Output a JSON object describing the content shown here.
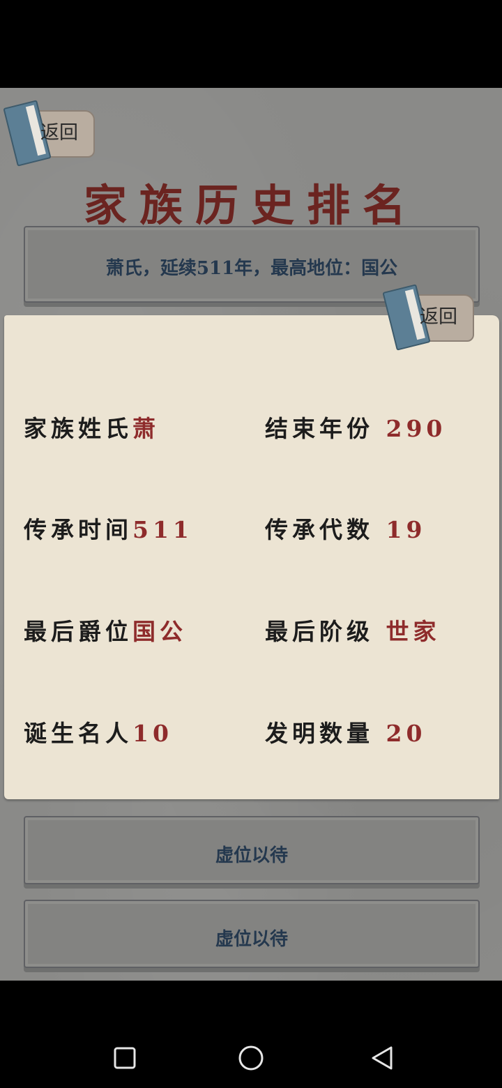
{
  "header": {
    "title": "家族历史排名",
    "back_label": "返回"
  },
  "summary_panel": {
    "text": "萧氏，延续511年，最高地位：国公"
  },
  "rank_slots": [
    {
      "label": "虚位以待"
    },
    {
      "label": "虚位以待"
    }
  ],
  "detail_popup": {
    "back_label": "返回",
    "stats": [
      {
        "key": "家族姓氏",
        "value": "萧"
      },
      {
        "key": "结束年份",
        "value": "290"
      },
      {
        "key": "传承时间",
        "value": "511"
      },
      {
        "key": "传承代数",
        "value": "19"
      },
      {
        "key": "最后爵位",
        "value": "国公"
      },
      {
        "key": "最后阶级",
        "value": "世家"
      },
      {
        "key": "诞生名人",
        "value": "10"
      },
      {
        "key": "发明数量",
        "value": "20"
      }
    ]
  },
  "colors": {
    "title": "#6b2420",
    "value": "#8e2b2b",
    "panel_text": "#24384e",
    "parchment": "#ece4d3"
  },
  "icons": [
    "book-scroll-icon",
    "square-icon",
    "circle-icon",
    "triangle-back-icon"
  ]
}
